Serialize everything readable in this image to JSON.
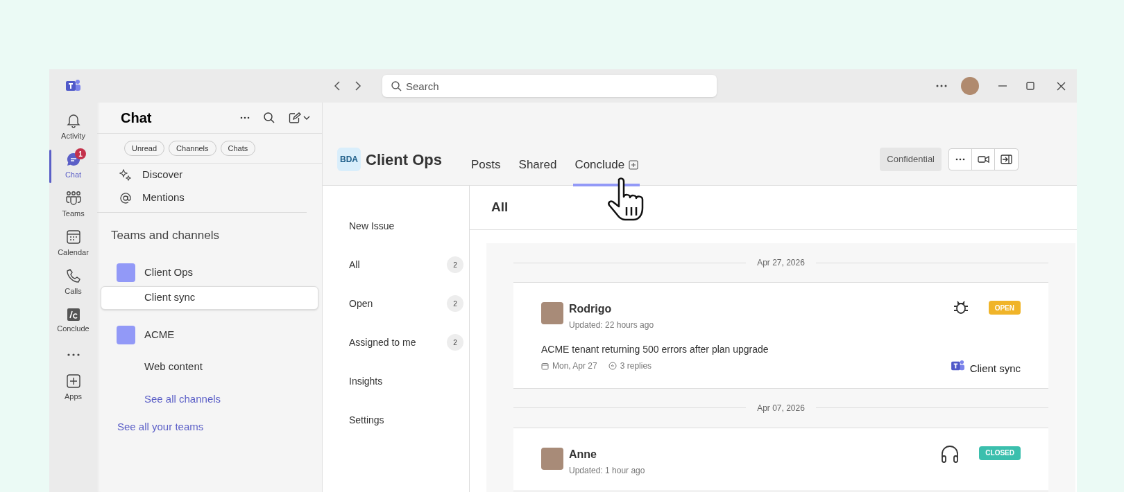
{
  "window": {
    "search_placeholder": "Search"
  },
  "rail": [
    {
      "label": "Activity",
      "kind": "activity",
      "selected": false
    },
    {
      "label": "Chat",
      "kind": "chat",
      "selected": true,
      "badge": "1"
    },
    {
      "label": "Teams",
      "kind": "teams",
      "selected": false
    },
    {
      "label": "Calendar",
      "kind": "calendar",
      "selected": false
    },
    {
      "label": "Calls",
      "kind": "calls",
      "selected": false
    },
    {
      "label": "Conclude",
      "kind": "conclude",
      "selected": false
    },
    {
      "kind": "more",
      "selected": false
    },
    {
      "label": "Apps",
      "kind": "apps",
      "selected": false
    }
  ],
  "chat_panel": {
    "title": "Chat",
    "filters": [
      "Unread",
      "Channels",
      "Chats"
    ],
    "quick_links": [
      {
        "label": "Discover",
        "kind": "discover"
      },
      {
        "label": "Mentions",
        "kind": "mentions"
      }
    ],
    "section_title": "Teams and channels",
    "teams": [
      {
        "name": "Client Ops",
        "channels": [
          {
            "name": "Client sync",
            "selected": true
          }
        ]
      },
      {
        "name": "ACME",
        "channels": [
          {
            "name": "Web content",
            "selected": false
          }
        ],
        "link": "See all channels"
      }
    ],
    "footer_link": "See all your teams"
  },
  "channel_header": {
    "logo": "BDA",
    "title": "Client Ops",
    "tabs": [
      {
        "label": "Posts",
        "selected": false
      },
      {
        "label": "Shared",
        "selected": false
      },
      {
        "label": "Conclude",
        "selected": true
      }
    ],
    "label": "Confidential"
  },
  "issue_nav": [
    {
      "label": "New Issue"
    },
    {
      "label": "All",
      "count": "2"
    },
    {
      "label": "Open",
      "count": "2"
    },
    {
      "label": "Assigned to me",
      "count": "2"
    },
    {
      "label": "Insights"
    },
    {
      "label": "Settings"
    }
  ],
  "feed": {
    "title": "All",
    "groups": [
      {
        "date": "Apr 27, 2026",
        "issues": [
          {
            "author": "Rodrigo",
            "updated": "Updated: 22 hours ago",
            "kind": "bug",
            "status": "OPEN",
            "color": "#f0b429",
            "title": "ACME tenant returning 500 errors after plan upgrade",
            "date": "Mon, Apr 27",
            "replies": "3 replies",
            "channel": "Client sync"
          }
        ]
      },
      {
        "date": "Apr 07, 2026",
        "issues": [
          {
            "author": "Anne",
            "updated": "Updated: 1 hour ago",
            "kind": "support",
            "status": "CLOSED",
            "color": "#3bbfad"
          }
        ]
      }
    ]
  }
}
